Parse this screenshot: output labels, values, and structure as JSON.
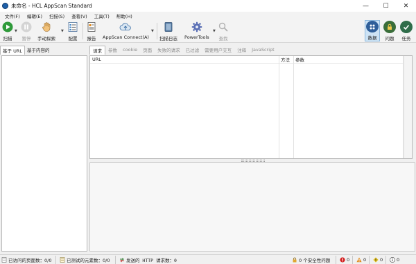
{
  "window": {
    "title": "未命名 - HCL AppScan Standard",
    "minimize": "—",
    "maximize": "☐",
    "close": "✕"
  },
  "menu": [
    "文件(F)",
    "编辑(E)",
    "扫描(S)",
    "查看(V)",
    "工具(T)",
    "帮助(H)"
  ],
  "toolbar": {
    "scan": "扫描",
    "pause": "暂停",
    "manual_explore": "手动探索",
    "config": "配置",
    "report": "报告",
    "appscan_connect": "AppScan Connect(A)",
    "scan_log": "扫描日志",
    "powertools": "PowerTools",
    "find": "查找"
  },
  "view_buttons": {
    "data": "数据",
    "issues": "问题",
    "tasks": "任务"
  },
  "left_tabs": [
    "基于 URL",
    "基于内容的"
  ],
  "right_tabs": [
    "请求",
    "参数",
    "cookie",
    "页面",
    "失败的请求",
    "已过滤",
    "需要用户交互",
    "注释",
    "JavaScript"
  ],
  "grid_columns": [
    "URL",
    "方法",
    "参数"
  ],
  "status": {
    "visited_pages": "已访问的页面数：0/0",
    "tested_elements": "已测试的元素数：0/0",
    "http_requests": "发送的 HTTP 请求数：0",
    "security_issues": "0 个安全性问题",
    "high_count": "0",
    "medium_count": "0",
    "low_count": "0",
    "info_count": "0"
  },
  "colors": {
    "accent_active": "#cde3f5",
    "high": "#d32020",
    "medium": "#e08a1e",
    "low": "#e6c21a",
    "info": "#8a8a8a"
  }
}
